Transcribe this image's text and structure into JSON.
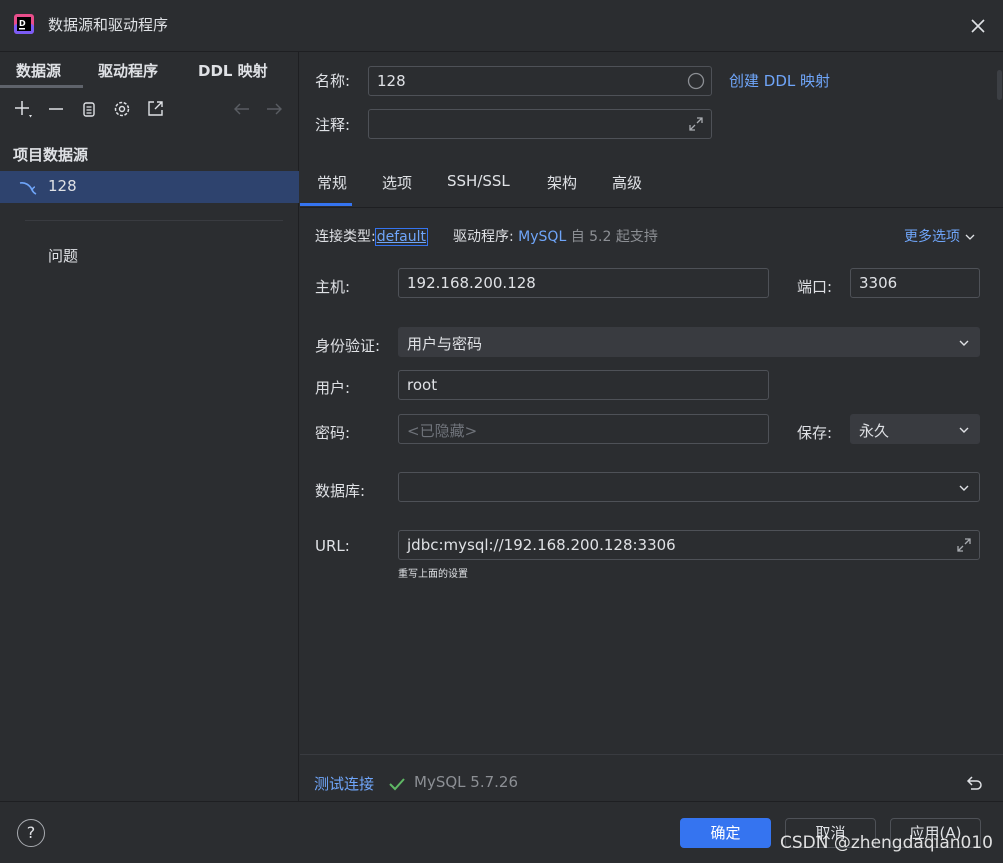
{
  "window": {
    "title": "数据源和驱动程序"
  },
  "sidebar": {
    "tabs": [
      "数据源",
      "驱动程序",
      "DDL 映射"
    ],
    "section_label": "项目数据源",
    "datasource": {
      "name": "128"
    },
    "problems_label": "问题"
  },
  "general": {
    "name_label": "名称:",
    "name_value": "128",
    "create_ddl_link": "创建 DDL 映射",
    "comment_label": "注释:",
    "comment_value": ""
  },
  "tabs": [
    "常规",
    "选项",
    "SSH/SSL",
    "架构",
    "高级"
  ],
  "connection": {
    "type_label": "连接类型:",
    "type_value": "default",
    "driver_label": "驱动程序:",
    "driver_value": "MySQL",
    "driver_note": "自 5.2 起支持",
    "more_options": "更多选项"
  },
  "fields": {
    "host_label": "主机:",
    "host_value": "192.168.200.128",
    "port_label": "端口:",
    "port_value": "3306",
    "auth_label": "身份验证:",
    "auth_value": "用户与密码",
    "user_label": "用户:",
    "user_value": "root",
    "password_label": "密码:",
    "password_placeholder": "<已隐藏>",
    "save_label": "保存:",
    "save_value": "永久",
    "database_label": "数据库:",
    "database_value": "",
    "url_label": "URL:",
    "url_value": "jdbc:mysql://192.168.200.128:3306",
    "url_hint": "重写上面的设置"
  },
  "test": {
    "link": "测试连接",
    "result": "MySQL 5.7.26"
  },
  "buttons": {
    "help": "?",
    "ok": "确定",
    "cancel": "取消",
    "apply": "应用(A)"
  },
  "watermark": "CSDN @zhengdaqian010",
  "colors": {
    "accent": "#3574f0",
    "link": "#6fa5f9",
    "background": "#2b2d30",
    "selection": "#2e436e",
    "success": "#5fb865"
  }
}
